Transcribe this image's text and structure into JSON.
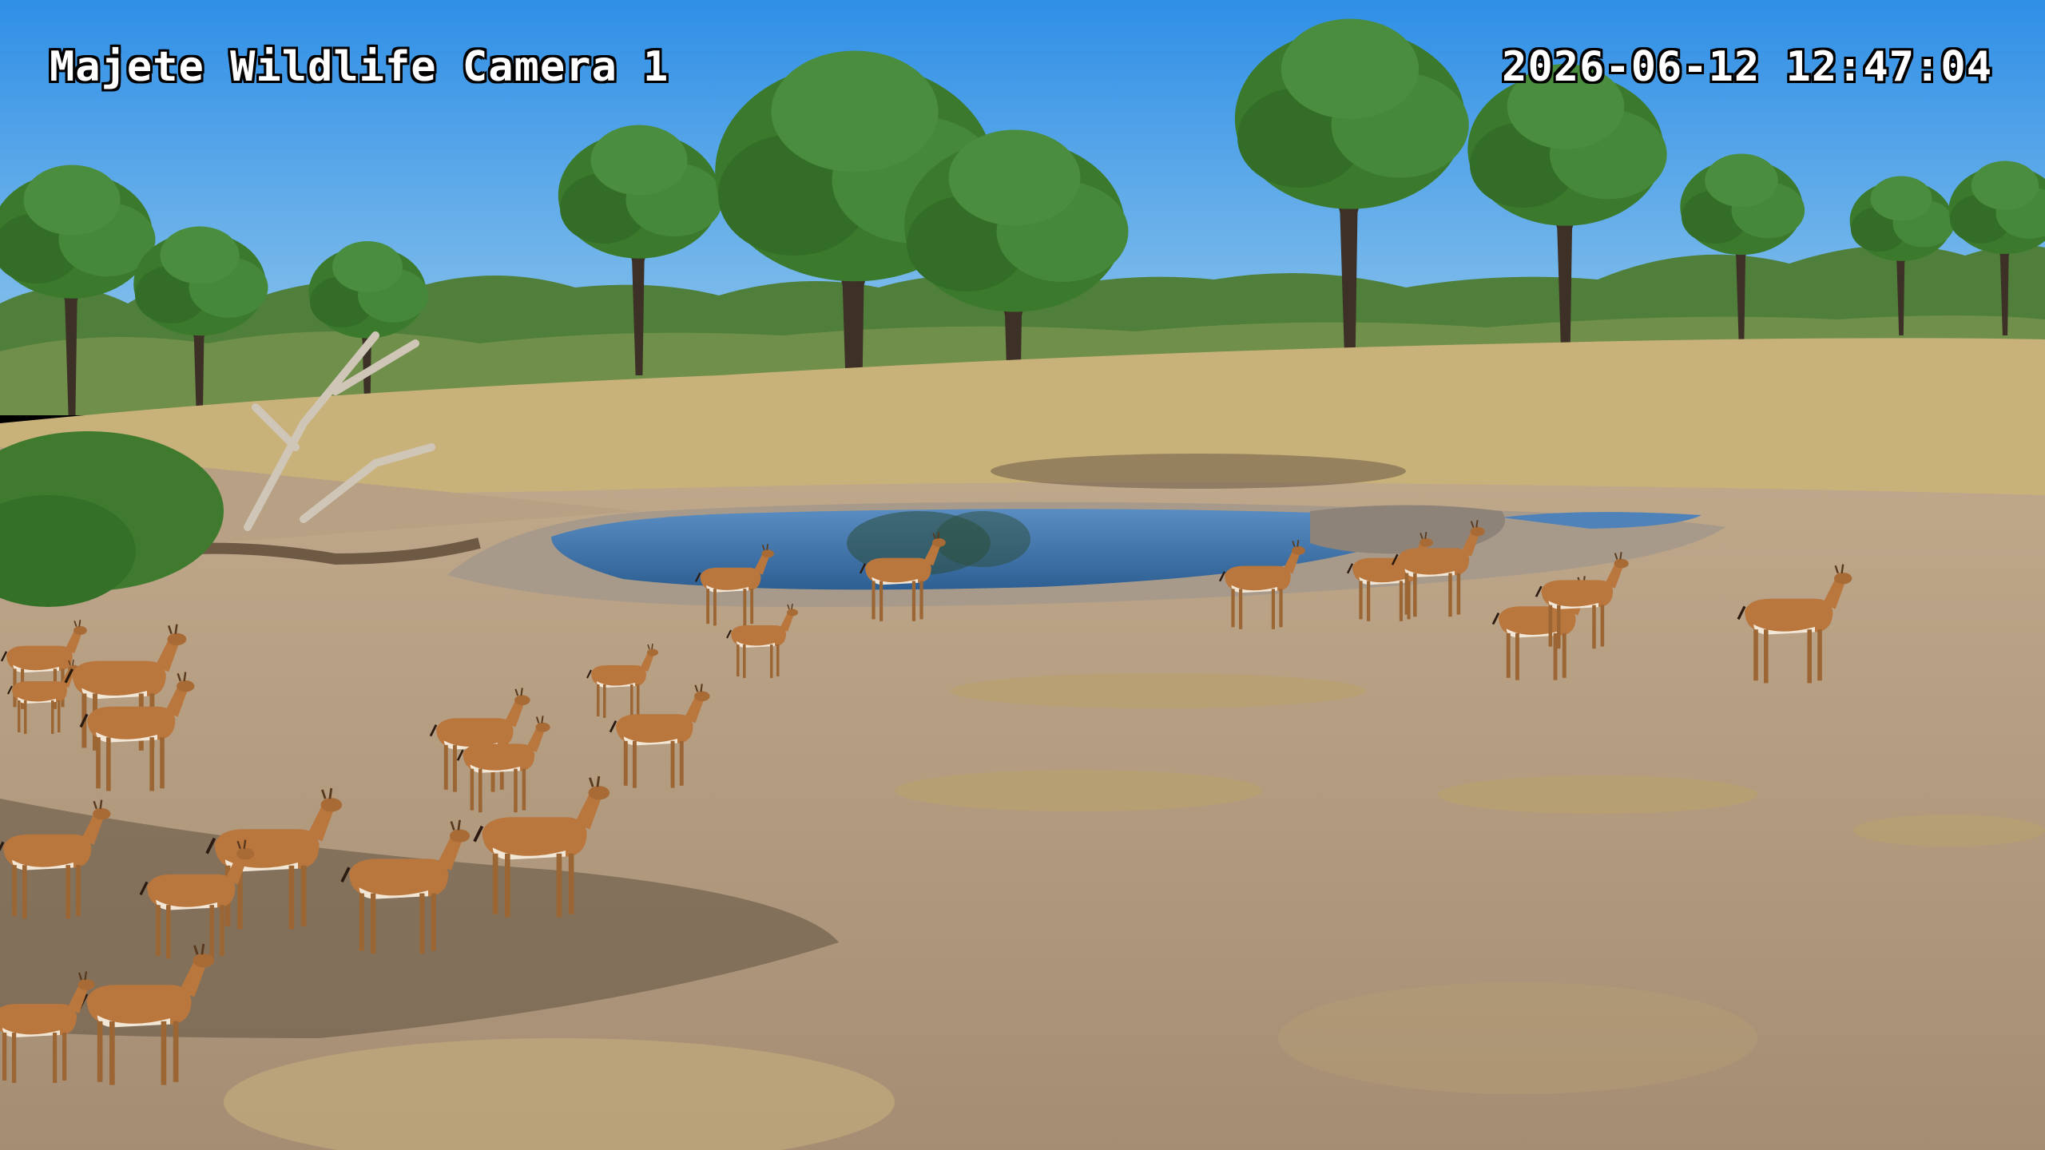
{
  "overlay": {
    "camera_title": "Majete Wildlife Camera 1",
    "timestamp": "2026-06-12 12:47:04"
  },
  "scene": {
    "subject": "impala herd at waterhole",
    "colors": {
      "sky": "#3f9ae6",
      "ground": "#b59c82",
      "grass": "#c9b27a",
      "water": "#3d6fa6",
      "foliage": "#3b7a2c",
      "impala": "#b9773e"
    }
  }
}
